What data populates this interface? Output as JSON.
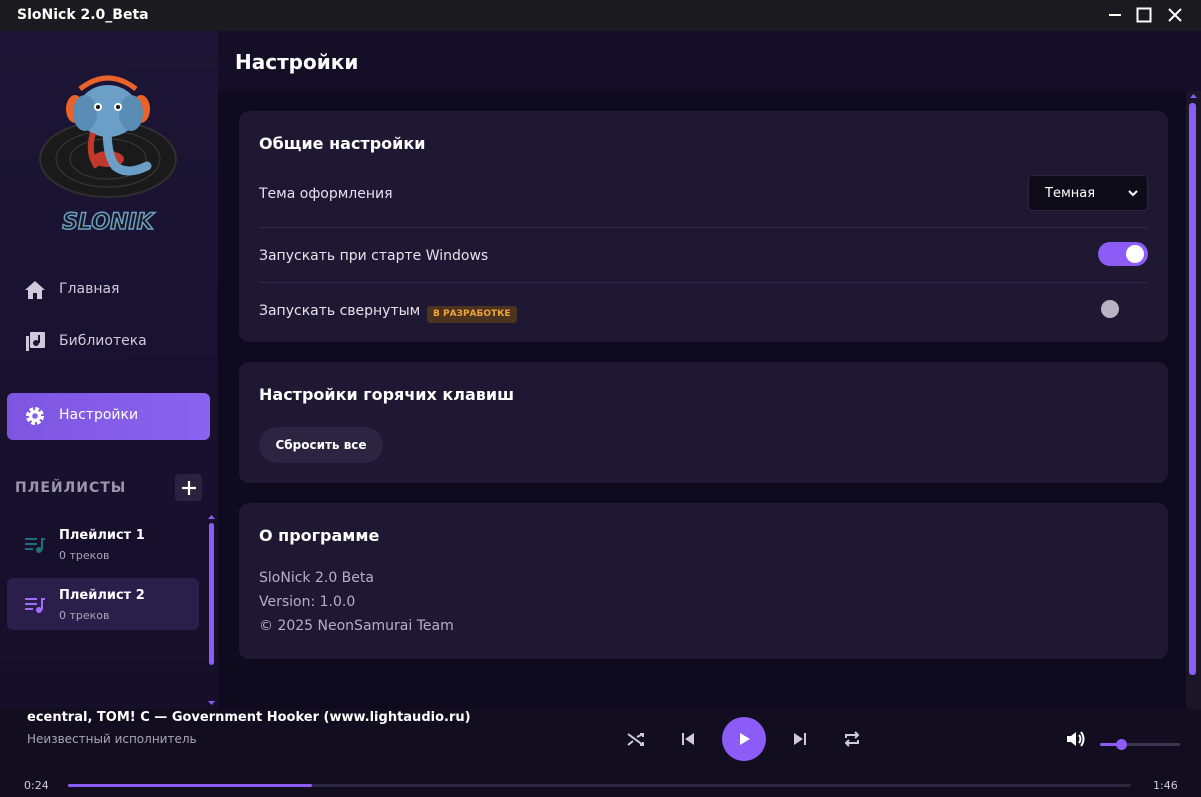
{
  "window": {
    "title": "SloNick 2.0_Beta"
  },
  "logo": {
    "text": "SLONIK"
  },
  "nav": [
    {
      "label": "Главная",
      "icon": "home-icon"
    },
    {
      "label": "Библиотека",
      "icon": "library-icon"
    },
    {
      "label": "Настройки",
      "icon": "gear-icon",
      "active": true
    }
  ],
  "playlists": {
    "header": "ПЛЕЙЛИСТЫ",
    "items": [
      {
        "name": "Плейлист 1",
        "count": "0 треков"
      },
      {
        "name": "Плейлист 2",
        "count": "0 треков",
        "active": true
      }
    ]
  },
  "page": {
    "title": "Настройки"
  },
  "general": {
    "title": "Общие настройки",
    "theme_label": "Тема оформления",
    "theme_value": "Темная",
    "autostart_label": "Запускать при старте Windows",
    "autostart_on": true,
    "minimized_label": "Запускать свернутым",
    "minimized_badge": "В РАЗРАБОТКЕ",
    "minimized_on": false
  },
  "hotkeys": {
    "title": "Настройки горячих клавиш",
    "reset_label": "Сбросить все"
  },
  "about": {
    "title": "О программе",
    "name": "SloNick 2.0 Beta",
    "version": "Version: 1.0.0",
    "copyright": "© 2025 NeonSamurai Team"
  },
  "player": {
    "track": "ecentral, TOM! C — Government Hooker (www.lightaudio.ru)",
    "artist": "Неизвестный исполнитель",
    "current_time": "0:24",
    "total_time": "1:46",
    "progress": 0.23,
    "volume": 0.27
  },
  "colors": {
    "accent": "#8b5cf6",
    "background": "#0f0b1e",
    "card": "#1e1833",
    "badge_text": "#f0a33b"
  }
}
